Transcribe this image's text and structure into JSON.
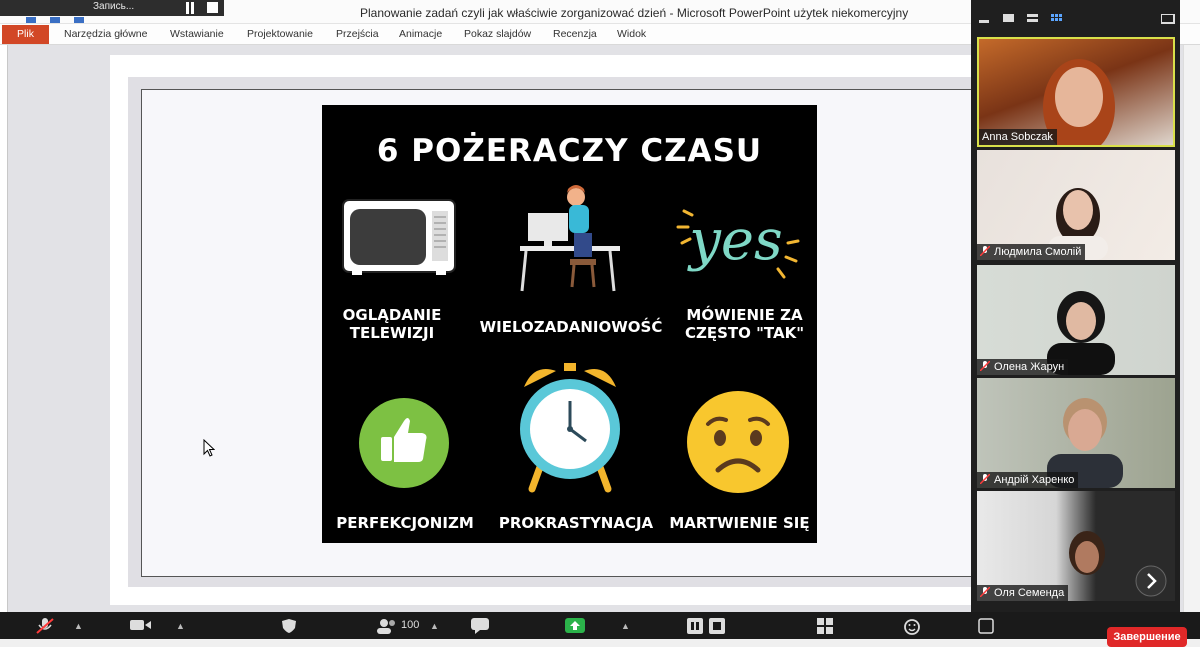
{
  "window": {
    "title": "Planowanie zadań czyli jak właściwie zorganizować dzień  -  Microsoft PowerPoint użytek niekomercyjny",
    "recording_label": "Запись..."
  },
  "ribbon": {
    "file_tab": "Plik",
    "tabs": [
      "Narzędzia główne",
      "Wstawianie",
      "Projektowanie",
      "Przejścia",
      "Animacje",
      "Pokaz slajdów",
      "Recenzja",
      "Widok"
    ]
  },
  "slide": {
    "title": "6 POŻERACZY CZASU",
    "items": [
      {
        "label_line1": "OGLĄDANIE",
        "label_line2": "TELEWIZJI",
        "icon": "television-icon"
      },
      {
        "label_line1": "WIELOZADANIOWOŚĆ",
        "label_line2": "",
        "icon": "person-at-desk-icon"
      },
      {
        "label_line1": "MÓWIENIE ZA",
        "label_line2": "CZĘSTO \"TAK\"",
        "icon": "yes-lettering-icon",
        "icon_text": "yes"
      },
      {
        "label_line1": "PERFEKCJONIZM",
        "label_line2": "",
        "icon": "thumbs-up-icon"
      },
      {
        "label_line1": "PROKRASTYNACJA",
        "label_line2": "",
        "icon": "alarm-clock-icon"
      },
      {
        "label_line1": "MARTWIENIE SIĘ",
        "label_line2": "",
        "icon": "worried-face-icon"
      }
    ]
  },
  "participants": [
    {
      "name": "Anna Sobczak",
      "muted": false,
      "active_speaker": true
    },
    {
      "name": "Людмила Смолій",
      "muted": true,
      "active_speaker": false
    },
    {
      "name": "Олена Жарун",
      "muted": true,
      "active_speaker": false
    },
    {
      "name": "Андрій Харенко",
      "muted": true,
      "active_speaker": false
    },
    {
      "name": "Оля Семенда",
      "muted": true,
      "active_speaker": false
    }
  ],
  "toolbar": {
    "participant_count": "100",
    "end_label": "Завершение"
  },
  "colors": {
    "accent_file_tab": "#d24726",
    "active_speaker_border": "#d9e04a",
    "end_button": "#e02828",
    "share_green": "#2bb34a"
  }
}
